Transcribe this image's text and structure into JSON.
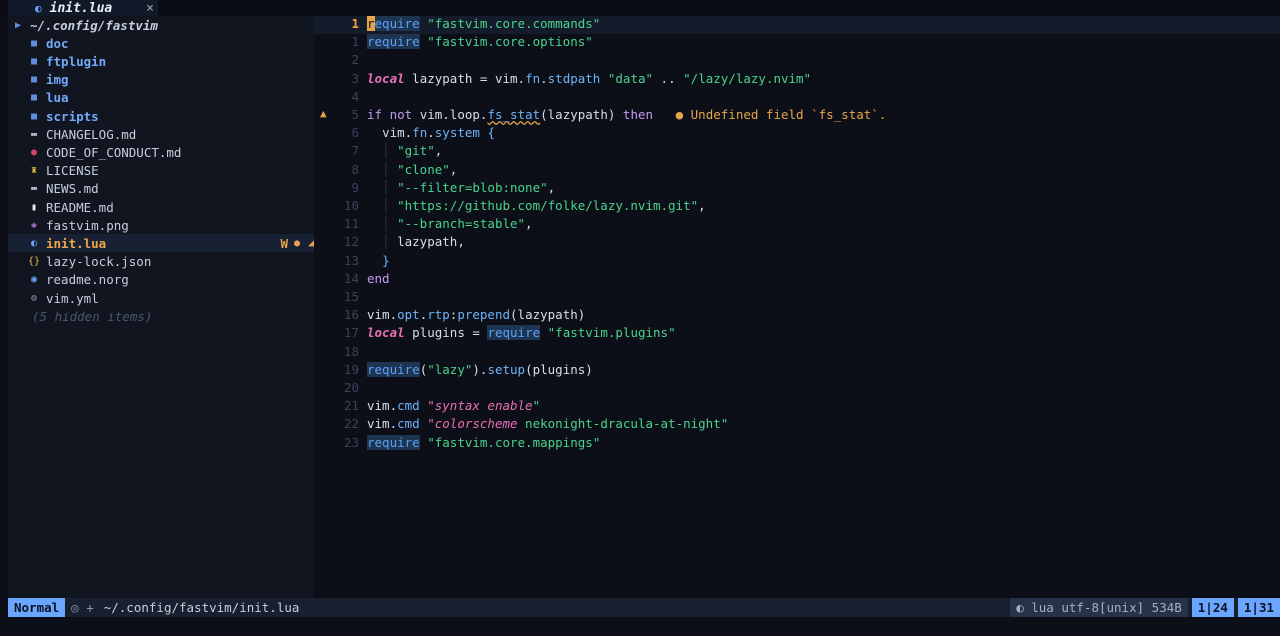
{
  "tab": {
    "icon": "lua-moon-icon",
    "name": "init.lua",
    "close": "×"
  },
  "explorer": {
    "root": "~/.config/fastvim",
    "items": [
      {
        "name": "doc",
        "kind": "dir",
        "icon": "folder-icon",
        "glyph": "■",
        "color": "#5f8fdc"
      },
      {
        "name": "ftplugin",
        "kind": "dir",
        "icon": "folder-icon",
        "glyph": "■",
        "color": "#5f8fdc"
      },
      {
        "name": "img",
        "kind": "dir",
        "icon": "folder-icon",
        "glyph": "■",
        "color": "#5f8fdc"
      },
      {
        "name": "lua",
        "kind": "dir",
        "icon": "folder-icon",
        "glyph": "■",
        "color": "#5f8fdc"
      },
      {
        "name": "scripts",
        "kind": "dir",
        "icon": "folder-icon",
        "glyph": "■",
        "color": "#5f8fdc"
      },
      {
        "name": "CHANGELOG.md",
        "kind": "file",
        "icon": "markdown-icon",
        "glyph": "▬",
        "color": "#a9b3c4"
      },
      {
        "name": "CODE_OF_CONDUCT.md",
        "kind": "file",
        "icon": "heart-icon",
        "glyph": "●",
        "color": "#d0456a"
      },
      {
        "name": "LICENSE",
        "kind": "file",
        "icon": "license-icon",
        "glyph": "♜",
        "color": "#e3c04a"
      },
      {
        "name": "NEWS.md",
        "kind": "file",
        "icon": "markdown-icon",
        "glyph": "▬",
        "color": "#a9b3c4"
      },
      {
        "name": "README.md",
        "kind": "file",
        "icon": "readme-icon",
        "glyph": "▮",
        "color": "#e9eef7"
      },
      {
        "name": "fastvim.png",
        "kind": "file",
        "icon": "image-icon",
        "glyph": "◈",
        "color": "#b07cdb"
      },
      {
        "name": "init.lua",
        "kind": "file",
        "icon": "lua-icon",
        "glyph": "◐",
        "color": "#6aa6ff",
        "active": true,
        "git": "W",
        "gitdot": "●",
        "diag": "◢"
      },
      {
        "name": "lazy-lock.json",
        "kind": "file",
        "icon": "json-icon",
        "glyph": "{}",
        "color": "#e3c04a"
      },
      {
        "name": "readme.norg",
        "kind": "file",
        "icon": "neorg-icon",
        "glyph": "◉",
        "color": "#6aa6ff"
      },
      {
        "name": "vim.yml",
        "kind": "file",
        "icon": "gear-icon",
        "glyph": "⚙",
        "color": "#8c98ad"
      }
    ],
    "hidden": "(5 hidden items)"
  },
  "editor": {
    "lines": [
      {
        "num": "1",
        "cur": true,
        "tokens": [
          [
            "cursor",
            "r"
          ],
          [
            "kw-req",
            "equire"
          ],
          [
            "op",
            " "
          ],
          [
            "str",
            "\"fastvim.core.commands\""
          ]
        ]
      },
      {
        "num": "1",
        "tokens": [
          [
            "kw-req",
            "require"
          ],
          [
            "op",
            " "
          ],
          [
            "str",
            "\"fastvim.core.options\""
          ]
        ]
      },
      {
        "num": "2",
        "tokens": []
      },
      {
        "num": "3",
        "tokens": [
          [
            "kw-local",
            "local"
          ],
          [
            "var",
            " lazypath = vim."
          ],
          [
            "fn",
            "fn"
          ],
          [
            "var",
            "."
          ],
          [
            "fn",
            "stdpath"
          ],
          [
            "op",
            " "
          ],
          [
            "str",
            "\"data\""
          ],
          [
            "op",
            " .. "
          ],
          [
            "str",
            "\"/lazy/lazy.nvim\""
          ]
        ]
      },
      {
        "num": "4",
        "tokens": []
      },
      {
        "num": "5",
        "sign": "▲",
        "tokens": [
          [
            "kw",
            "if"
          ],
          [
            "op",
            " "
          ],
          [
            "kw",
            "not"
          ],
          [
            "var",
            " vim.loop."
          ],
          [
            "fn warn-under",
            "fs_stat"
          ],
          [
            "punct",
            "(lazypath) "
          ],
          [
            "kw",
            "then"
          ],
          [
            "op",
            "   "
          ],
          [
            "diag",
            "● Undefined field `fs_stat`."
          ]
        ]
      },
      {
        "num": "6",
        "tokens": [
          [
            "indent",
            "  "
          ],
          [
            "var",
            "vim."
          ],
          [
            "fn",
            "fn"
          ],
          [
            "var",
            "."
          ],
          [
            "fn",
            "system"
          ],
          [
            "op",
            " "
          ],
          [
            "bracket",
            "{"
          ]
        ]
      },
      {
        "num": "7",
        "tokens": [
          [
            "indent",
            "  │ "
          ],
          [
            "str",
            "\"git\""
          ],
          [
            "punct",
            ","
          ]
        ]
      },
      {
        "num": "8",
        "tokens": [
          [
            "indent",
            "  │ "
          ],
          [
            "str",
            "\"clone\""
          ],
          [
            "punct",
            ","
          ]
        ]
      },
      {
        "num": "9",
        "tokens": [
          [
            "indent",
            "  │ "
          ],
          [
            "str",
            "\"--filter=blob:none\""
          ],
          [
            "punct",
            ","
          ]
        ]
      },
      {
        "num": "10",
        "tokens": [
          [
            "indent",
            "  │ "
          ],
          [
            "str",
            "\"https://github.com/folke/lazy.nvim.git\""
          ],
          [
            "punct",
            ","
          ]
        ]
      },
      {
        "num": "11",
        "tokens": [
          [
            "indent",
            "  │ "
          ],
          [
            "str",
            "\"--branch=stable\""
          ],
          [
            "punct",
            ","
          ]
        ]
      },
      {
        "num": "12",
        "tokens": [
          [
            "indent",
            "  │ "
          ],
          [
            "var",
            "lazypath"
          ],
          [
            "punct",
            ","
          ]
        ]
      },
      {
        "num": "13",
        "tokens": [
          [
            "indent",
            "  "
          ],
          [
            "bracket",
            "}"
          ]
        ]
      },
      {
        "num": "14",
        "tokens": [
          [
            "kw",
            "end"
          ]
        ]
      },
      {
        "num": "15",
        "tokens": []
      },
      {
        "num": "16",
        "tokens": [
          [
            "var",
            "vim."
          ],
          [
            "fn",
            "opt"
          ],
          [
            "var",
            "."
          ],
          [
            "fn",
            "rtp"
          ],
          [
            "var",
            ":"
          ],
          [
            "fn",
            "prepend"
          ],
          [
            "punct",
            "(lazypath)"
          ]
        ]
      },
      {
        "num": "17",
        "tokens": [
          [
            "kw-local",
            "local"
          ],
          [
            "var",
            " plugins = "
          ],
          [
            "kw-req",
            "require"
          ],
          [
            "op",
            " "
          ],
          [
            "str",
            "\"fastvim.plugins\""
          ]
        ]
      },
      {
        "num": "18",
        "tokens": []
      },
      {
        "num": "19",
        "tokens": [
          [
            "kw-req",
            "require"
          ],
          [
            "punct",
            "("
          ],
          [
            "str",
            "\"lazy\""
          ],
          [
            "punct",
            ")."
          ],
          [
            "fn",
            "setup"
          ],
          [
            "punct",
            "(plugins)"
          ]
        ]
      },
      {
        "num": "20",
        "tokens": []
      },
      {
        "num": "21",
        "tokens": [
          [
            "var",
            "vim."
          ],
          [
            "fn",
            "cmd"
          ],
          [
            "op",
            " "
          ],
          [
            "ital-str",
            "\"syntax enable"
          ],
          [
            "str",
            "\""
          ]
        ]
      },
      {
        "num": "22",
        "tokens": [
          [
            "var",
            "vim."
          ],
          [
            "fn",
            "cmd"
          ],
          [
            "op",
            " "
          ],
          [
            "ital-str",
            "\"colorscheme"
          ],
          [
            "str",
            " nekonight-dracula-at-night\""
          ]
        ]
      },
      {
        "num": "23",
        "tokens": [
          [
            "kw-req",
            "require"
          ],
          [
            "op",
            " "
          ],
          [
            "str",
            "\"fastvim.core.mappings\""
          ]
        ]
      }
    ]
  },
  "statusline": {
    "mode": "Normal",
    "icons": "◎ +",
    "path": "~/.config/fastvim/init.lua",
    "fileinfo": "◐ lua utf-8[unix] 534B",
    "pos1": "1|24",
    "pos2": "1|31"
  }
}
